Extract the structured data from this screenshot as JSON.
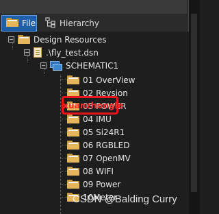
{
  "tabs": [
    {
      "label": "File",
      "icon": "folder-icon",
      "active": true
    },
    {
      "label": "Hierarchy",
      "icon": "hierarchy-icon",
      "active": false
    }
  ],
  "tree": {
    "root": {
      "label": "Design Resources"
    },
    "project": {
      "label": ".\\fly_test.dsn"
    },
    "schematic": {
      "label": "SCHEMATIC1"
    },
    "pages": [
      "01 OverView",
      "02 Revsion",
      "03 POWER",
      "04 IMU",
      "05 Si24R1",
      "06 RGBLED",
      "07 OpenMV",
      "08 WIFI",
      "09 Power",
      "10Meter"
    ]
  },
  "overlay": {
    "highlight_text": "xuanzhongle",
    "highlight_color": "#e8161b"
  },
  "watermark": "CSDN @Balding Curry"
}
